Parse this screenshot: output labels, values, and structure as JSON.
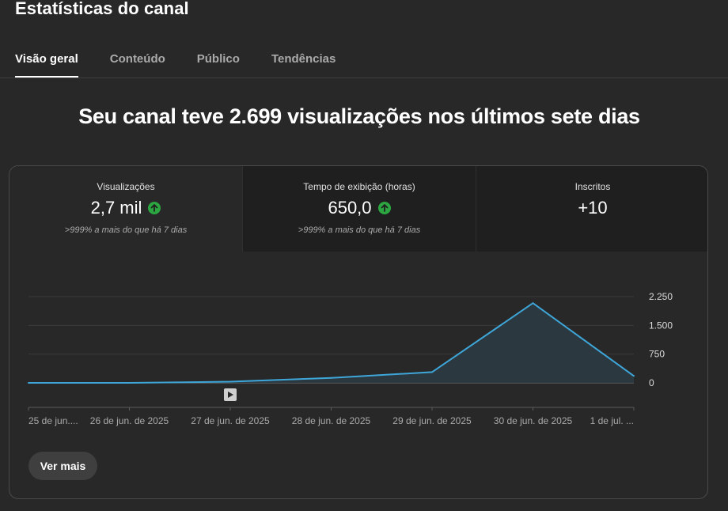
{
  "page_title": "Estatísticas do canal",
  "tabs": [
    {
      "label": "Visão geral",
      "active": true
    },
    {
      "label": "Conteúdo",
      "active": false
    },
    {
      "label": "Público",
      "active": false
    },
    {
      "label": "Tendências",
      "active": false
    }
  ],
  "headline": "Seu canal teve 2.699 visualizações nos últimos sete dias",
  "metrics": [
    {
      "label": "Visualizações",
      "value": "2,7 mil",
      "trend": "up",
      "comparison": ">999% a mais do que há 7 dias"
    },
    {
      "label": "Tempo de exibição (horas)",
      "value": "650,0",
      "trend": "up",
      "comparison": ">999% a mais do que há 7 dias"
    },
    {
      "label": "Inscritos",
      "value": "+10"
    }
  ],
  "chart_data": {
    "type": "area",
    "categories": [
      "25 de jun....",
      "26 de jun. de 2025",
      "27 de jun. de 2025",
      "28 de jun. de 2025",
      "29 de jun. de 2025",
      "30 de jun. de 2025",
      "1 de jul. ..."
    ],
    "values": [
      0,
      0,
      30,
      130,
      280,
      2080,
      180
    ],
    "y_ticks": [
      "2.250",
      "1.500",
      "750",
      "0"
    ],
    "ylim": [
      0,
      2250
    ],
    "line_color": "#3ea6d8",
    "fill_color": "#2b3a42",
    "grid": true
  },
  "see_more_label": "Ver mais",
  "colors": {
    "background": "#282828",
    "trend_up": "#2ba640"
  }
}
